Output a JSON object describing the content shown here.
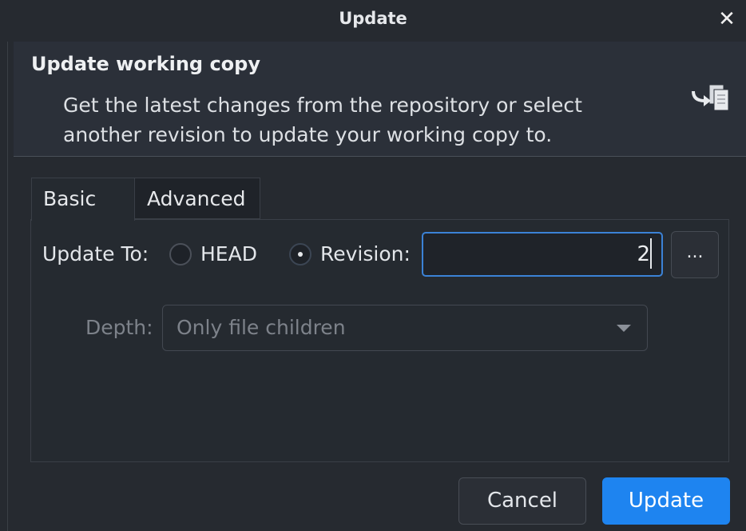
{
  "window": {
    "title": "Update",
    "close_glyph": "✕"
  },
  "header": {
    "title": "Update working copy",
    "description_line1": "Get the latest changes from the repository or select",
    "description_line2": "another revision to update your working copy to.",
    "icon": "update-revision-icon"
  },
  "tabs": [
    {
      "label": "Basic",
      "selected": true
    },
    {
      "label": "Advanced",
      "selected": false
    }
  ],
  "basic": {
    "update_to_label": "Update To:",
    "head_label": "HEAD",
    "head_selected": false,
    "revision_label": "Revision:",
    "revision_selected": true,
    "revision_value": "2",
    "browse_label": "...",
    "depth_label": "Depth:",
    "depth_value": "Only file children",
    "depth_enabled": false
  },
  "buttons": {
    "cancel": "Cancel",
    "update": "Update"
  },
  "colors": {
    "accent": "#1e84f0",
    "focus_border": "#3b82d6",
    "background": "#262a30",
    "header_background": "#2b3039"
  }
}
